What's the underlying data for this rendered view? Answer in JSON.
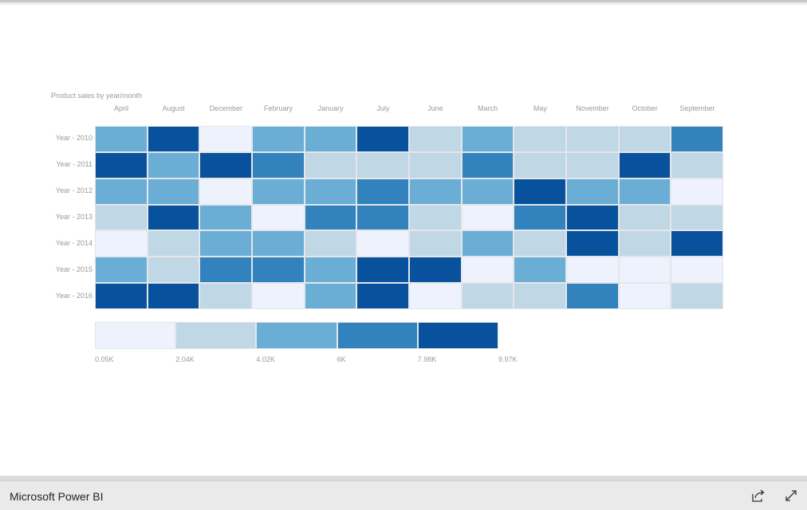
{
  "visual": {
    "title": "Product sales by year/month",
    "months": [
      "April",
      "August",
      "December",
      "February",
      "January",
      "July",
      "June",
      "March",
      "May",
      "November",
      "October",
      "September"
    ],
    "years": [
      "Year - 2010",
      "Year - 2011",
      "Year - 2012",
      "Year - 2013",
      "Year - 2014",
      "Year - 2015",
      "Year - 2016"
    ],
    "color_scale": [
      "#eef2fd",
      "#c0d7e6",
      "#6aaed6",
      "#3182bd",
      "#08519c"
    ],
    "legend_ticks": [
      "0.05K",
      "2.04K",
      "4.02K",
      "6K",
      "7.98K",
      "9.97K"
    ],
    "cell_buckets": [
      [
        2,
        4,
        0,
        2,
        2,
        4,
        1,
        2,
        1,
        1,
        1,
        3
      ],
      [
        4,
        2,
        4,
        3,
        1,
        1,
        1,
        3,
        1,
        1,
        4,
        1
      ],
      [
        2,
        2,
        0,
        2,
        2,
        3,
        2,
        2,
        4,
        2,
        2,
        0
      ],
      [
        1,
        4,
        2,
        0,
        3,
        3,
        1,
        0,
        3,
        4,
        1,
        1
      ],
      [
        0,
        1,
        2,
        2,
        1,
        0,
        1,
        2,
        1,
        4,
        1,
        4
      ],
      [
        2,
        1,
        3,
        3,
        2,
        4,
        4,
        0,
        2,
        0,
        0,
        0
      ],
      [
        4,
        4,
        1,
        0,
        2,
        4,
        0,
        1,
        1,
        3,
        0,
        1
      ]
    ]
  },
  "footer": {
    "brand": "Microsoft Power BI",
    "share_icon": "share-icon",
    "fullscreen_icon": "fullscreen-icon"
  }
}
